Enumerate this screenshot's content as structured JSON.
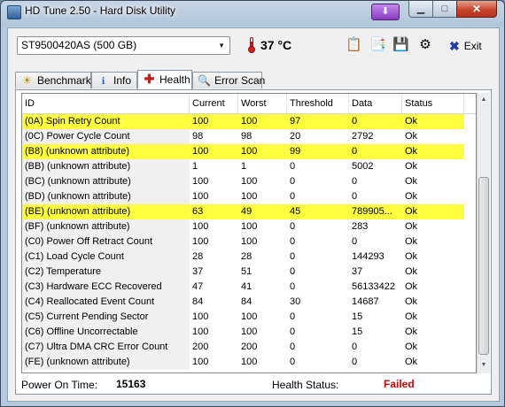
{
  "window": {
    "title": "HD Tune 2.50 - Hard Disk Utility",
    "controls": {
      "minimize": "▁",
      "maximize": "□",
      "close": "✕"
    },
    "download_icon": "download-arrow-icon"
  },
  "toolbar": {
    "drive": "ST9500420AS (500 GB)",
    "temperature": "37 °C",
    "exit_label": "Exit"
  },
  "tabs": [
    {
      "label": "Benchmark",
      "icon": "benchmark-icon"
    },
    {
      "label": "Info",
      "icon": "info-icon"
    },
    {
      "label": "Health",
      "icon": "health-cross-icon"
    },
    {
      "label": "Error Scan",
      "icon": "magnifier-icon"
    }
  ],
  "active_tab": "Health",
  "table": {
    "columns": [
      "ID",
      "Current",
      "Worst",
      "Threshold",
      "Data",
      "Status"
    ],
    "rows": [
      {
        "id": "(0A) Spin Retry Count",
        "current": "100",
        "worst": "100",
        "threshold": "97",
        "data": "0",
        "status": "Ok",
        "highlight": true
      },
      {
        "id": "(0C) Power Cycle Count",
        "current": "98",
        "worst": "98",
        "threshold": "20",
        "data": "2792",
        "status": "Ok",
        "highlight": false
      },
      {
        "id": "(B8) (unknown attribute)",
        "current": "100",
        "worst": "100",
        "threshold": "99",
        "data": "0",
        "status": "Ok",
        "highlight": true
      },
      {
        "id": "(BB) (unknown attribute)",
        "current": "1",
        "worst": "1",
        "threshold": "0",
        "data": "5002",
        "status": "Ok",
        "highlight": false
      },
      {
        "id": "(BC) (unknown attribute)",
        "current": "100",
        "worst": "100",
        "threshold": "0",
        "data": "0",
        "status": "Ok",
        "highlight": false
      },
      {
        "id": "(BD) (unknown attribute)",
        "current": "100",
        "worst": "100",
        "threshold": "0",
        "data": "0",
        "status": "Ok",
        "highlight": false
      },
      {
        "id": "(BE) (unknown attribute)",
        "current": "63",
        "worst": "49",
        "threshold": "45",
        "data": "789905...",
        "status": "Ok",
        "highlight": true
      },
      {
        "id": "(BF) (unknown attribute)",
        "current": "100",
        "worst": "100",
        "threshold": "0",
        "data": "283",
        "status": "Ok",
        "highlight": false
      },
      {
        "id": "(C0) Power Off Retract Count",
        "current": "100",
        "worst": "100",
        "threshold": "0",
        "data": "0",
        "status": "Ok",
        "highlight": false
      },
      {
        "id": "(C1) Load Cycle Count",
        "current": "28",
        "worst": "28",
        "threshold": "0",
        "data": "144293",
        "status": "Ok",
        "highlight": false
      },
      {
        "id": "(C2) Temperature",
        "current": "37",
        "worst": "51",
        "threshold": "0",
        "data": "37",
        "status": "Ok",
        "highlight": false
      },
      {
        "id": "(C3) Hardware ECC Recovered",
        "current": "47",
        "worst": "41",
        "threshold": "0",
        "data": "56133422",
        "status": "Ok",
        "highlight": false
      },
      {
        "id": "(C4) Reallocated Event Count",
        "current": "84",
        "worst": "84",
        "threshold": "30",
        "data": "14687",
        "status": "Ok",
        "highlight": false
      },
      {
        "id": "(C5) Current Pending Sector",
        "current": "100",
        "worst": "100",
        "threshold": "0",
        "data": "15",
        "status": "Ok",
        "highlight": false
      },
      {
        "id": "(C6) Offline Uncorrectable",
        "current": "100",
        "worst": "100",
        "threshold": "0",
        "data": "15",
        "status": "Ok",
        "highlight": false
      },
      {
        "id": "(C7) Ultra DMA CRC Error Count",
        "current": "200",
        "worst": "200",
        "threshold": "0",
        "data": "0",
        "status": "Ok",
        "highlight": false
      },
      {
        "id": "(FE) (unknown attribute)",
        "current": "100",
        "worst": "100",
        "threshold": "0",
        "data": "0",
        "status": "Ok",
        "highlight": false
      }
    ]
  },
  "footer": {
    "power_on_label": "Power On Time:",
    "power_on_value": "15163",
    "health_label": "Health Status:",
    "health_value": "Failed"
  },
  "colors": {
    "highlight_row": "#ffff40",
    "failed_text": "#cc0000"
  }
}
